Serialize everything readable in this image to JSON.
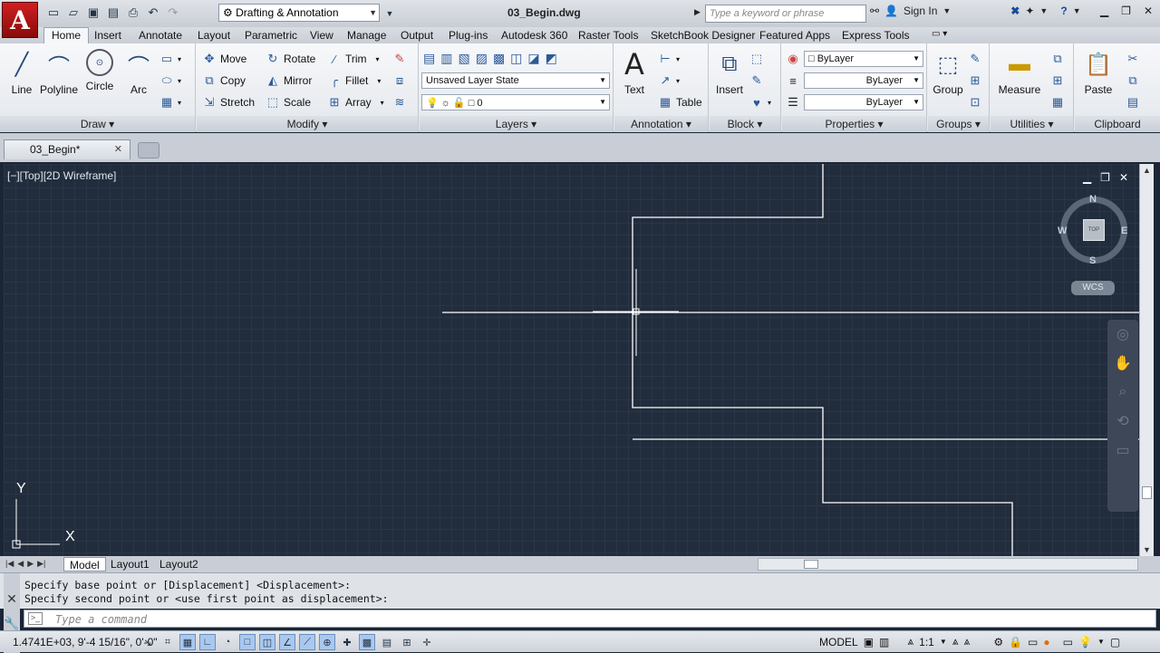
{
  "app": {
    "logo": "A",
    "workspace": "Drafting & Annotation",
    "document_title": "03_Begin.dwg",
    "search_placeholder": "Type a keyword or phrase",
    "sign_in": "Sign In"
  },
  "ribbon_tabs": [
    "Home",
    "Insert",
    "Annotate",
    "Layout",
    "Parametric",
    "View",
    "Manage",
    "Output",
    "Plug-ins",
    "Autodesk 360",
    "Raster Tools",
    "SketchBook Designer",
    "Featured Apps",
    "Express Tools"
  ],
  "panels": {
    "draw": {
      "title": "Draw",
      "line": "Line",
      "polyline": "Polyline",
      "circle": "Circle",
      "arc": "Arc"
    },
    "modify": {
      "title": "Modify",
      "move": "Move",
      "rotate": "Rotate",
      "trim": "Trim",
      "copy": "Copy",
      "mirror": "Mirror",
      "fillet": "Fillet",
      "stretch": "Stretch",
      "scale": "Scale",
      "array": "Array"
    },
    "layers": {
      "title": "Layers",
      "layer_state": "Unsaved Layer State",
      "current_layer": "0"
    },
    "annotation": {
      "title": "Annotation",
      "text": "Text",
      "table": "Table"
    },
    "block": {
      "title": "Block",
      "insert": "Insert"
    },
    "properties": {
      "title": "Properties",
      "color": "ByLayer",
      "linetype": "ByLayer",
      "lineweight": "ByLayer"
    },
    "groups": {
      "title": "Groups",
      "group": "Group"
    },
    "utilities": {
      "title": "Utilities",
      "measure": "Measure"
    },
    "clipboard": {
      "title": "Clipboard",
      "paste": "Paste"
    }
  },
  "doc_tab": "03_Begin*",
  "viewport": {
    "label": "[−][Top][2D Wireframe]",
    "cube_top": "TOP",
    "n": "N",
    "s": "S",
    "e": "E",
    "w": "W",
    "wcs": "WCS",
    "ucs_x": "X",
    "ucs_y": "Y"
  },
  "layout_tabs": [
    "Model",
    "Layout1",
    "Layout2"
  ],
  "command": {
    "line1": "Specify base point or [Displacement] <Displacement>:",
    "line2": "Specify second point or <use first point as displacement>:",
    "placeholder": "Type a command"
  },
  "status": {
    "coords": "1.4741E+03,  9'-4 15/16\", 0'-0\"",
    "model": "MODEL",
    "scale": "1:1"
  }
}
